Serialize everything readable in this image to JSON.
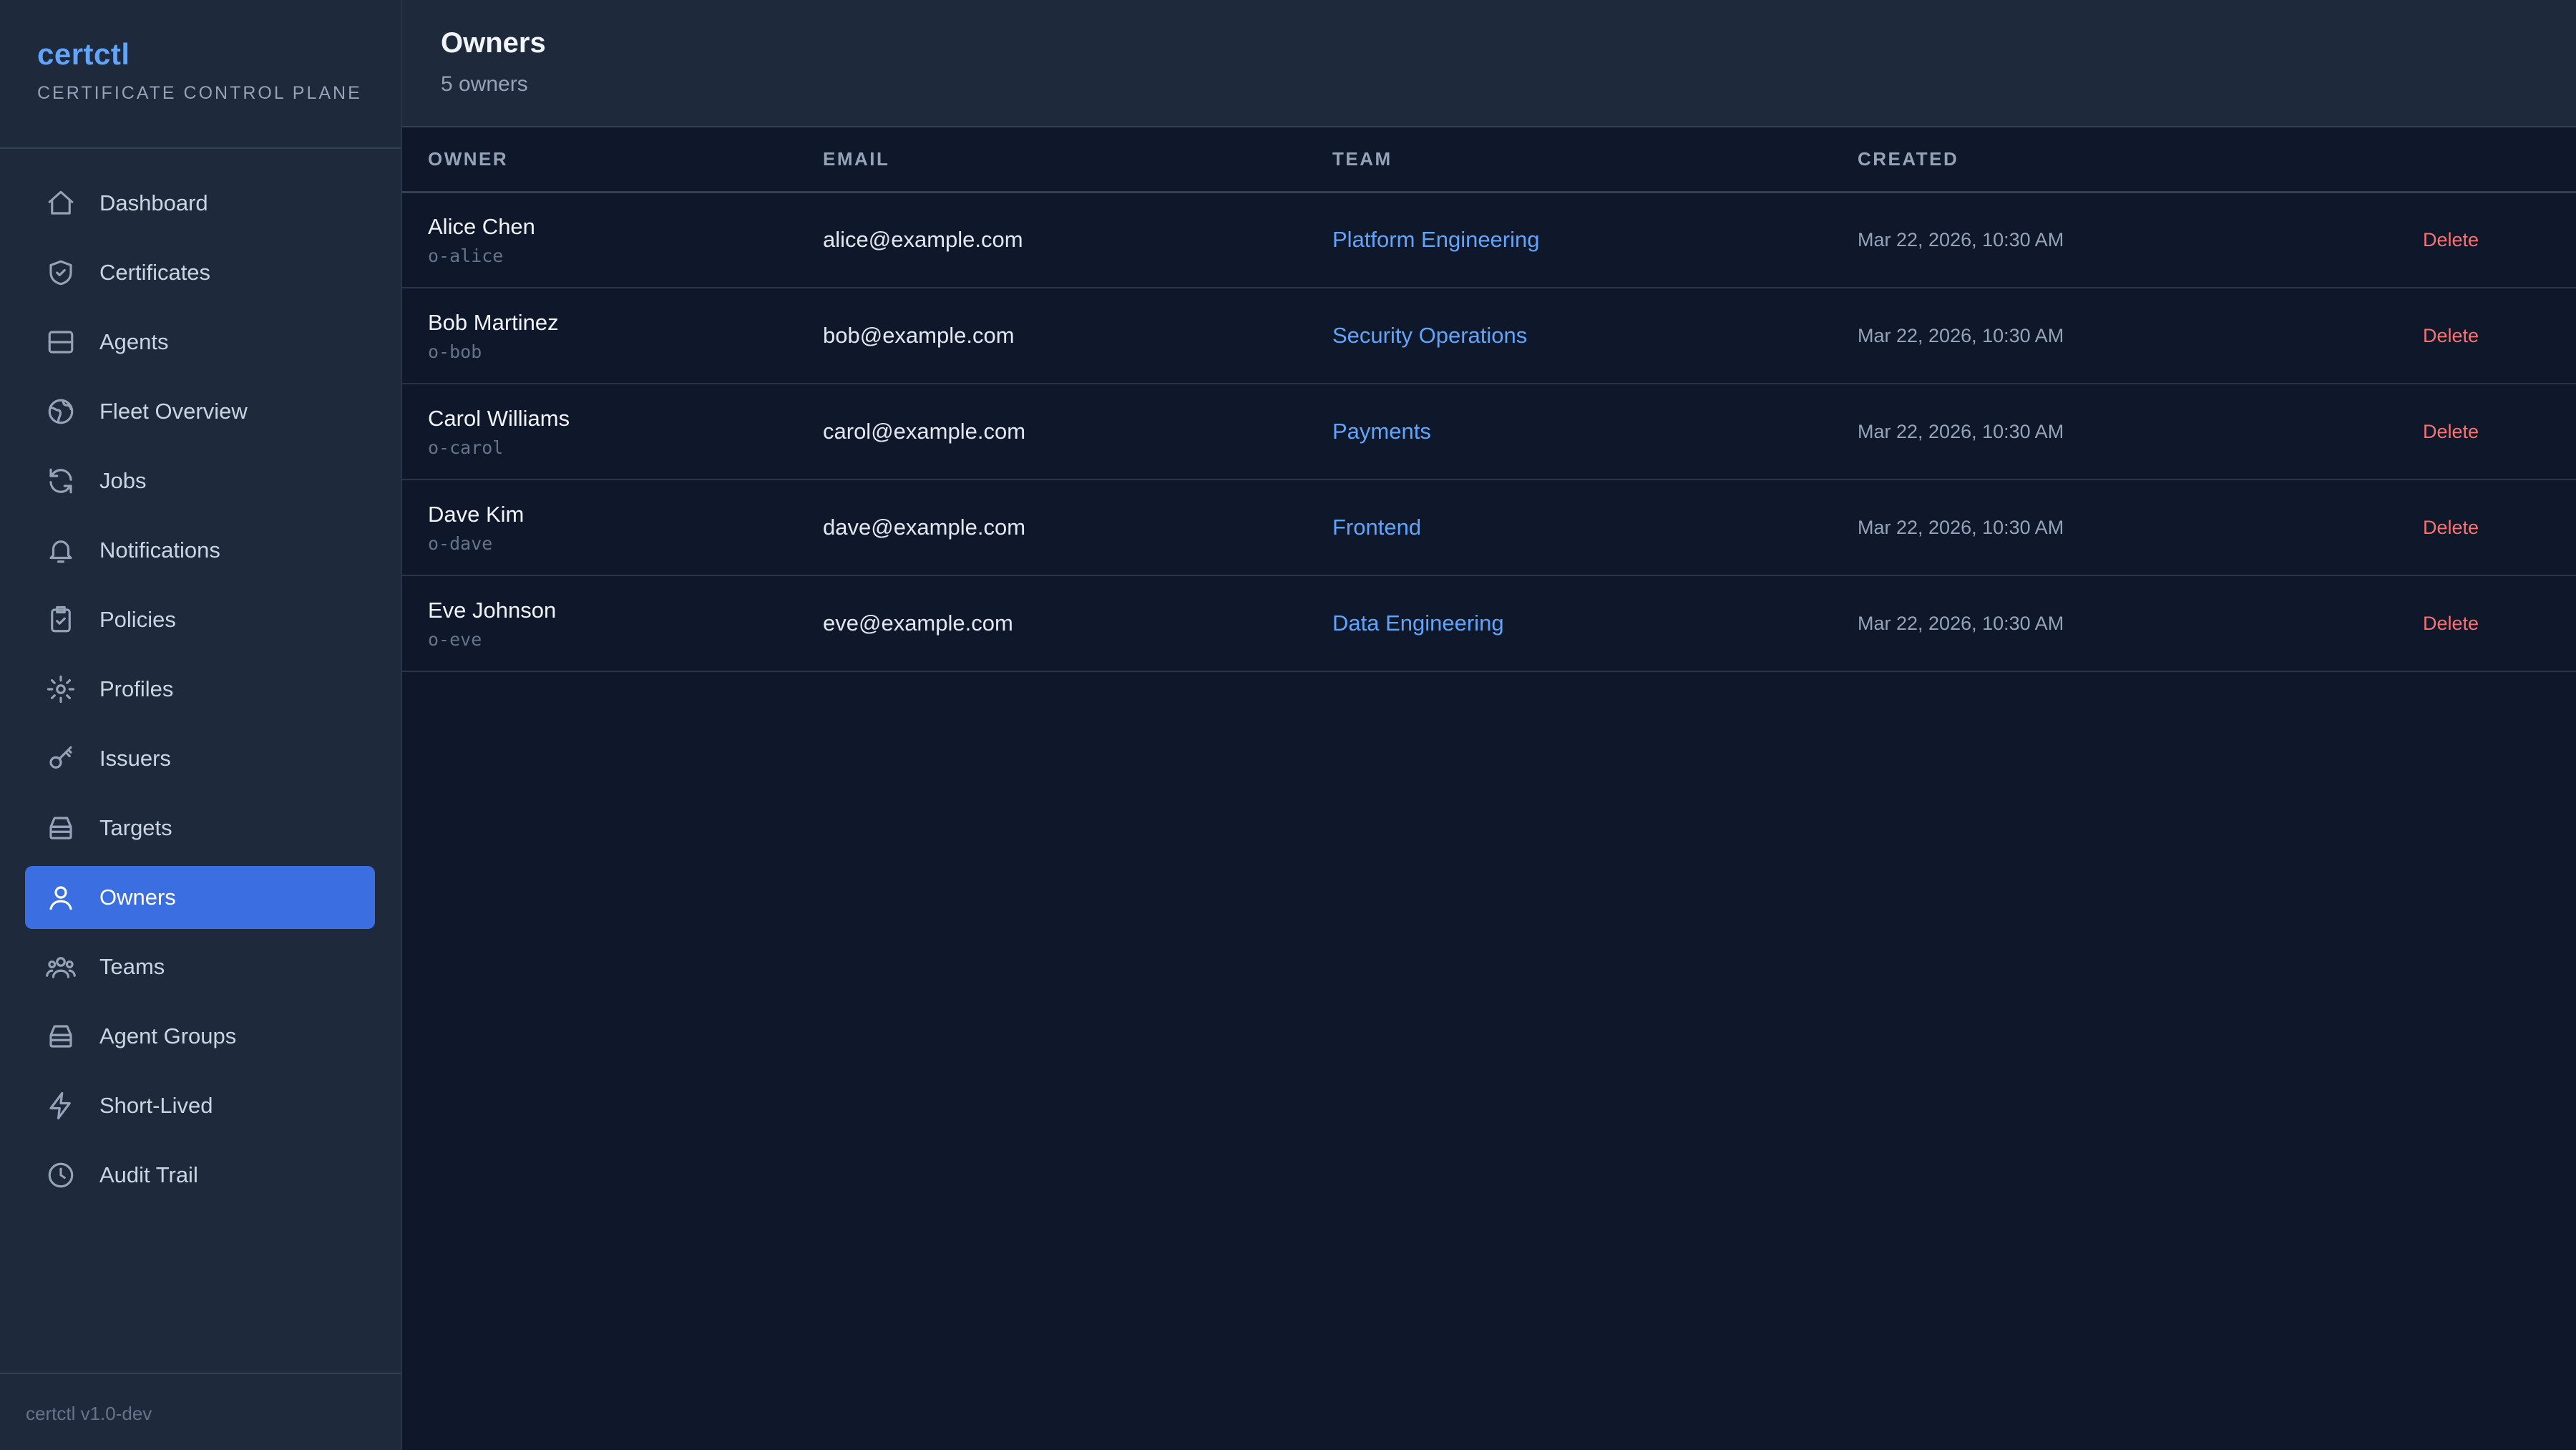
{
  "brand": {
    "name": "certctl",
    "subtitle": "CERTIFICATE CONTROL PLANE"
  },
  "sidebar": {
    "items": [
      {
        "label": "Dashboard",
        "icon": "home-icon"
      },
      {
        "label": "Certificates",
        "icon": "shield-icon"
      },
      {
        "label": "Agents",
        "icon": "server-icon"
      },
      {
        "label": "Fleet Overview",
        "icon": "globe-icon"
      },
      {
        "label": "Jobs",
        "icon": "refresh-icon"
      },
      {
        "label": "Notifications",
        "icon": "bell-icon"
      },
      {
        "label": "Policies",
        "icon": "clipboard-check-icon"
      },
      {
        "label": "Profiles",
        "icon": "gear-icon"
      },
      {
        "label": "Issuers",
        "icon": "key-icon"
      },
      {
        "label": "Targets",
        "icon": "stack-icon"
      },
      {
        "label": "Owners",
        "icon": "user-icon",
        "active": true
      },
      {
        "label": "Teams",
        "icon": "users-icon"
      },
      {
        "label": "Agent Groups",
        "icon": "stack-icon"
      },
      {
        "label": "Short-Lived",
        "icon": "bolt-icon"
      },
      {
        "label": "Audit Trail",
        "icon": "clock-icon"
      }
    ],
    "footer": "certctl v1.0-dev"
  },
  "header": {
    "title": "Owners",
    "subtitle": "5 owners"
  },
  "table": {
    "columns": [
      "OWNER",
      "EMAIL",
      "TEAM",
      "CREATED",
      ""
    ],
    "delete_label": "Delete",
    "rows": [
      {
        "name": "Alice Chen",
        "id": "o-alice",
        "email": "alice@example.com",
        "team": "Platform Engineering",
        "created": "Mar 22, 2026, 10:30 AM"
      },
      {
        "name": "Bob Martinez",
        "id": "o-bob",
        "email": "bob@example.com",
        "team": "Security Operations",
        "created": "Mar 22, 2026, 10:30 AM"
      },
      {
        "name": "Carol Williams",
        "id": "o-carol",
        "email": "carol@example.com",
        "team": "Payments",
        "created": "Mar 22, 2026, 10:30 AM"
      },
      {
        "name": "Dave Kim",
        "id": "o-dave",
        "email": "dave@example.com",
        "team": "Frontend",
        "created": "Mar 22, 2026, 10:30 AM"
      },
      {
        "name": "Eve Johnson",
        "id": "o-eve",
        "email": "eve@example.com",
        "team": "Data Engineering",
        "created": "Mar 22, 2026, 10:30 AM"
      }
    ]
  },
  "colors": {
    "accent": "#3b6ee0",
    "link": "#60a5fa",
    "danger": "#f87171",
    "background": "#0f172a",
    "sidebar": "#1e293b"
  }
}
